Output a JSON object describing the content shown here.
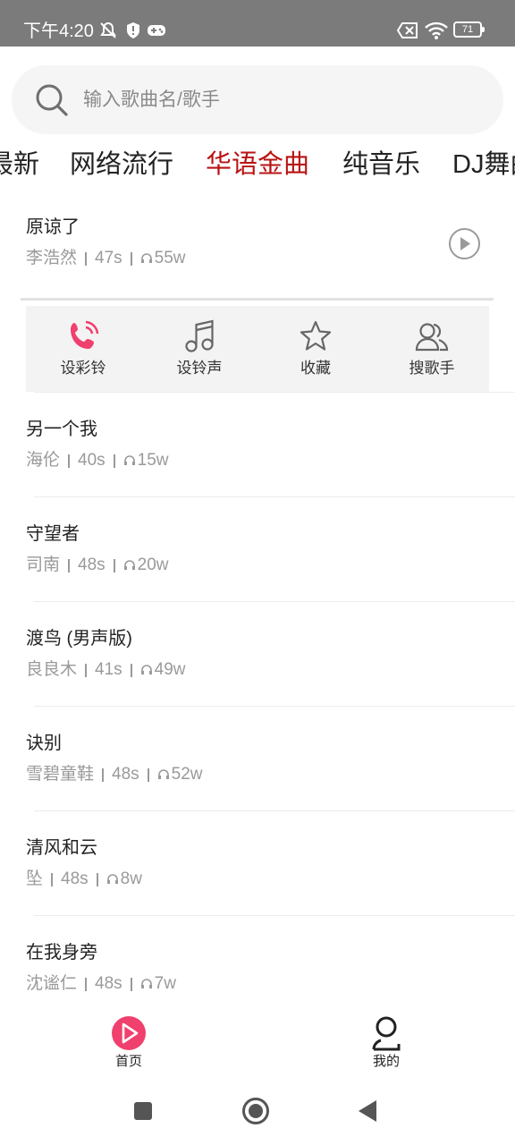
{
  "status_bar": {
    "time": "下午4:20",
    "battery": "71",
    "icons": [
      "mute-icon",
      "shield-icon",
      "gamepad-icon",
      "sim-off-icon",
      "wifi-icon",
      "battery-icon"
    ]
  },
  "search": {
    "placeholder": "输入歌曲名/歌手",
    "icon": "search-icon"
  },
  "tabs": [
    {
      "label": "最新"
    },
    {
      "label": "网络流行"
    },
    {
      "label": "华语金曲",
      "active": true
    },
    {
      "label": "纯音乐"
    },
    {
      "label": "DJ舞曲"
    }
  ],
  "songs": [
    {
      "title": "原谅了",
      "artist": "李浩然",
      "duration": "47s",
      "plays": "55w"
    },
    {
      "title": "另一个我",
      "artist": "海伦",
      "duration": "40s",
      "plays": "15w"
    },
    {
      "title": "守望者",
      "artist": "司南",
      "duration": "48s",
      "plays": "20w"
    },
    {
      "title": "渡鸟 (男声版)",
      "artist": "良良木",
      "duration": "41s",
      "plays": "49w"
    },
    {
      "title": "诀别",
      "artist": "雪碧童鞋",
      "duration": "48s",
      "plays": "52w"
    },
    {
      "title": "清风和云",
      "artist": "坠",
      "duration": "48s",
      "plays": "8w"
    },
    {
      "title": "在我身旁",
      "artist": "沈谧仁",
      "duration": "48s",
      "plays": "7w"
    }
  ],
  "actions": [
    {
      "label": "设彩铃",
      "icon": "phone-ring-icon",
      "color": "#f0406e"
    },
    {
      "label": "设铃声",
      "icon": "music-note-icon"
    },
    {
      "label": "收藏",
      "icon": "star-icon"
    },
    {
      "label": "搜歌手",
      "icon": "users-icon"
    }
  ],
  "bottom_nav": [
    {
      "label": "首页",
      "icon": "play-circle-icon",
      "active": true
    },
    {
      "label": "我的",
      "icon": "profile-icon"
    }
  ],
  "colors": {
    "accent": "#b81414",
    "pink": "#f0406e",
    "status_bar": "#7b7b7b"
  }
}
